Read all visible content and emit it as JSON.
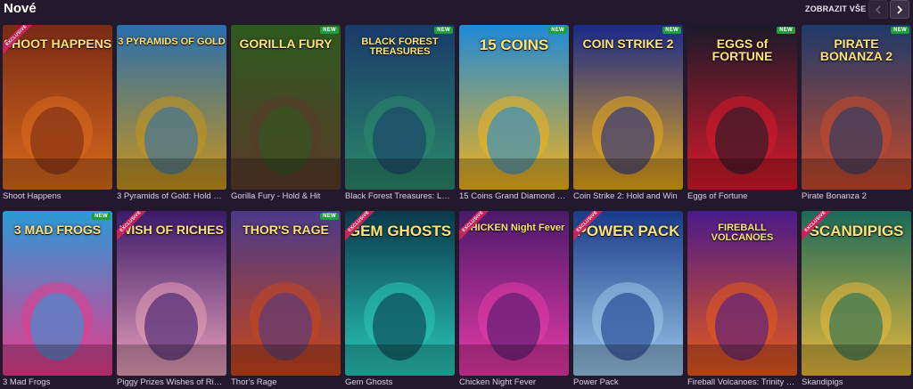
{
  "header": {
    "title": "Nové",
    "view_all": "ZOBRAZIT VŠE",
    "prev_icon": "chevron-left-icon",
    "next_icon": "chevron-right-icon"
  },
  "badges": {
    "new": "NEW",
    "exclusive": "EXCLUSIVE"
  },
  "games_row1": [
    {
      "name": "Shoot Happens",
      "logo": "SHOOT HAPPENS",
      "new": false,
      "exclusive": true,
      "colors": [
        "#7a2a14",
        "#d86a1c"
      ]
    },
    {
      "name": "3 Pyramids of Gold: Hold & ...",
      "logo": "3 PYRAMIDS OF GOLD",
      "new": false,
      "exclusive": false,
      "colors": [
        "#2a6fae",
        "#c8941a"
      ]
    },
    {
      "name": "Gorilla Fury - Hold & Hit",
      "logo": "GORILLA FURY",
      "new": true,
      "exclusive": false,
      "colors": [
        "#2d5a1e",
        "#5a3a2a"
      ]
    },
    {
      "name": "Black Forest Treasures: Loc...",
      "logo": "BLACK FOREST TREASURES",
      "new": true,
      "exclusive": false,
      "colors": [
        "#1a3a6a",
        "#2a8a6a"
      ]
    },
    {
      "name": "15 Coins Grand Diamond E...",
      "logo": "15 COINS",
      "new": true,
      "exclusive": false,
      "colors": [
        "#1e8ad8",
        "#f2b21a"
      ]
    },
    {
      "name": "Coin Strike 2: Hold and Win",
      "logo": "COIN STRIKE 2",
      "new": true,
      "exclusive": false,
      "colors": [
        "#1a2a8a",
        "#e8a81a"
      ]
    },
    {
      "name": "Eggs of Fortune",
      "logo": "EGGS of FORTUNE",
      "new": true,
      "exclusive": false,
      "colors": [
        "#1a1a2a",
        "#d81a2a"
      ]
    },
    {
      "name": "Pirate Bonanza 2",
      "logo": "PIRATE BONANZA 2",
      "new": true,
      "exclusive": false,
      "colors": [
        "#1e3a6a",
        "#c84a2a"
      ]
    }
  ],
  "games_row2": [
    {
      "name": "3 Mad Frogs",
      "logo": "3 MAD FROGS",
      "new": true,
      "exclusive": false,
      "colors": [
        "#2a9ad8",
        "#e83a8a"
      ]
    },
    {
      "name": "Piggy Prizes Wishes of Riches",
      "logo": "WISH OF RICHES",
      "new": false,
      "exclusive": true,
      "colors": [
        "#3a1a6a",
        "#e8a0b8"
      ]
    },
    {
      "name": "Thor's Rage",
      "logo": "THOR'S RAGE",
      "new": true,
      "exclusive": false,
      "colors": [
        "#4a3a8a",
        "#c8461a"
      ]
    },
    {
      "name": "Gem Ghosts",
      "logo": "GEM GHOSTS",
      "new": false,
      "exclusive": true,
      "colors": [
        "#0a3a4a",
        "#2ac8b8"
      ]
    },
    {
      "name": "Chicken Night Fever",
      "logo": "CHICKEN Night Fever",
      "new": false,
      "exclusive": true,
      "colors": [
        "#4a1a6a",
        "#e83aa8"
      ]
    },
    {
      "name": "Power Pack",
      "logo": "POWER PACK",
      "new": false,
      "exclusive": true,
      "colors": [
        "#1a3a8a",
        "#9ac8e8"
      ]
    },
    {
      "name": "Fireball Volcanoes: Trinity S...",
      "logo": "FIREBALL VOLCANOES",
      "new": false,
      "exclusive": false,
      "colors": [
        "#4a1a8a",
        "#e85a1a"
      ]
    },
    {
      "name": "Skandipigs",
      "logo": "SCANDIPIGS",
      "new": false,
      "exclusive": true,
      "colors": [
        "#1a6a5a",
        "#e8b83a"
      ]
    }
  ]
}
